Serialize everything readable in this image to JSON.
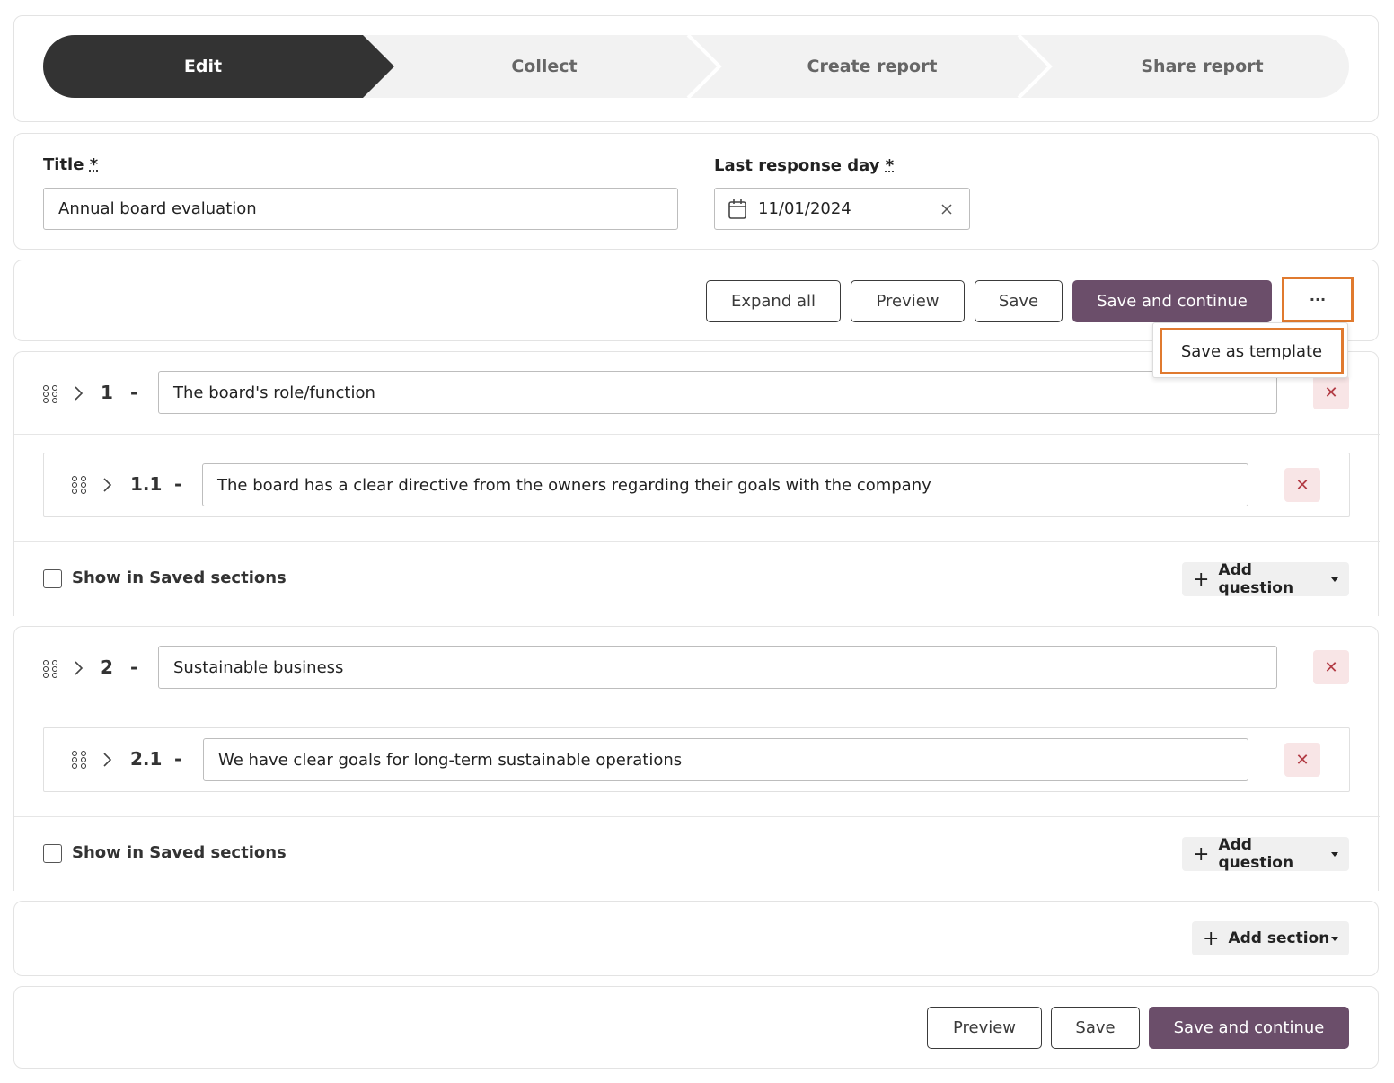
{
  "stepper": {
    "steps": [
      "Edit",
      "Collect",
      "Create report",
      "Share report"
    ],
    "active": "Edit"
  },
  "form": {
    "title_label": "Title",
    "title_value": "Annual board evaluation",
    "date_label": "Last response day",
    "date_value": "11/01/2024",
    "required_mark": "*"
  },
  "toolbar": {
    "expand_all": "Expand all",
    "preview": "Preview",
    "save": "Save",
    "save_continue": "Save and continue",
    "more": "···",
    "menu_item": "Save as template"
  },
  "sections": [
    {
      "number": "1",
      "title": "The board's role/function",
      "questions": [
        {
          "number": "1.1",
          "text": "The board has a clear directive from the owners regarding their goals with the company"
        }
      ],
      "show_saved_label": "Show in Saved sections",
      "add_question": "Add question"
    },
    {
      "number": "2",
      "title": "Sustainable business",
      "questions": [
        {
          "number": "2.1",
          "text": "We have clear goals for long-term sustainable operations"
        }
      ],
      "show_saved_label": "Show in Saved sections",
      "add_question": "Add question"
    }
  ],
  "add_section": "Add section",
  "footer": {
    "preview": "Preview",
    "save": "Save",
    "save_continue": "Save and continue"
  },
  "colors": {
    "primary": "#6b4e6a",
    "active_step": "#333333",
    "highlight": "#e07a2f",
    "delete_bg": "#f8e5e6"
  }
}
